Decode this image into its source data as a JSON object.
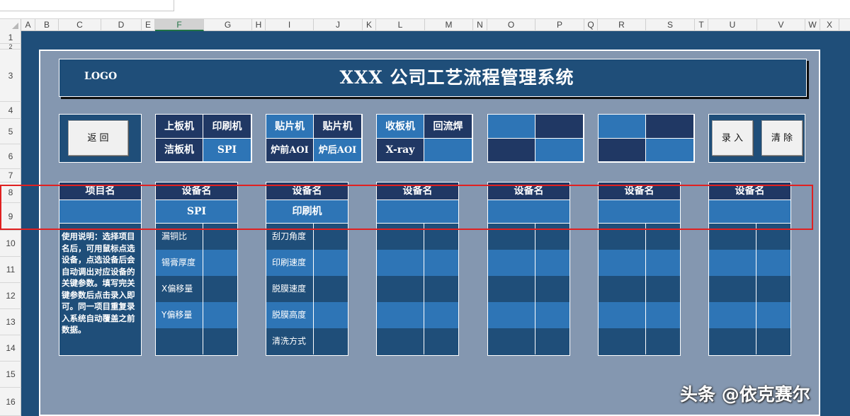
{
  "columns": [
    "A",
    "B",
    "C",
    "D",
    "E",
    "F",
    "G",
    "H",
    "I",
    "J",
    "K",
    "L",
    "M",
    "N",
    "O",
    "P",
    "Q",
    "R",
    "S",
    "T",
    "U",
    "V",
    "W",
    "X"
  ],
  "rows": [
    "1",
    "2",
    "3",
    "4",
    "5",
    "6",
    "7",
    "8",
    "9",
    "10",
    "11",
    "12",
    "13",
    "14",
    "15",
    "16"
  ],
  "title": {
    "logo": "LOGO",
    "text": "XXX 公司工艺流程管理系统"
  },
  "buttons": {
    "back": "返 回",
    "enter": "录 入",
    "clear": "清 除"
  },
  "nav": {
    "group1": [
      "上板机",
      "印刷机",
      "洁板机",
      "SPI"
    ],
    "group2": [
      "贴片机",
      "贴片机",
      "炉前AOI",
      "炉后AOI"
    ],
    "group3": [
      "收板机",
      "回流焊",
      "X-ray",
      ""
    ]
  },
  "cards": {
    "project_header": "项目名",
    "instructions": "使用说明：选择项目名后，可用鼠标点选设备，点选设备后会自动调出对应设备的关键参数。填写完关键参数后点击录入即可。同一项目重复录入系统自动覆盖之前数据。",
    "equipment_header": "设备名",
    "card1": {
      "selected": "SPI",
      "params": [
        "漏铜比",
        "锡膏厚度",
        "X偏移量",
        "Y偏移量",
        ""
      ]
    },
    "card2": {
      "selected": "印刷机",
      "params": [
        "刮刀角度",
        "印刷速度",
        "脱膜速度",
        "脱膜高度",
        "清洗方式"
      ]
    },
    "card3": {
      "selected": ""
    },
    "card4": {
      "selected": ""
    },
    "card5": {
      "selected": ""
    },
    "card6": {
      "selected": ""
    }
  },
  "watermark": "头条 @依克赛尔",
  "colors": {
    "canvas": "#1f4e79",
    "panel": "#8497b0",
    "dark": "#203864",
    "mid": "#2e75b6",
    "highlight": "#e02020"
  }
}
